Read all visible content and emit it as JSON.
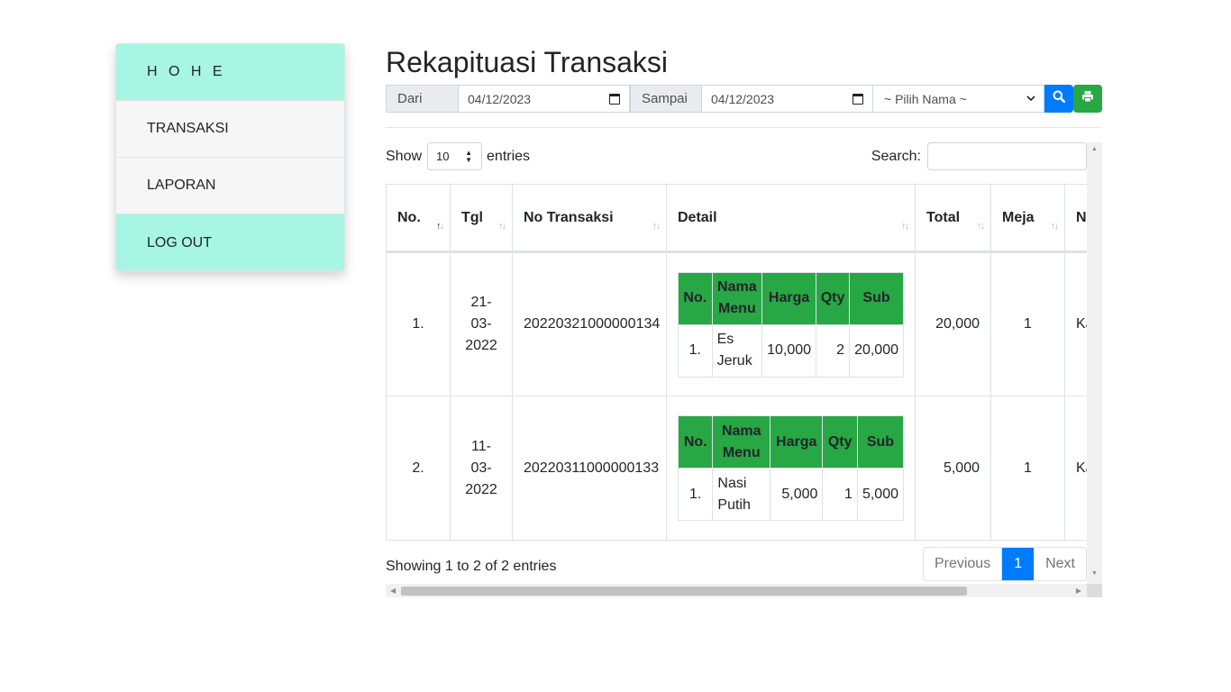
{
  "sidebar": {
    "items": [
      {
        "label": "H O H E"
      },
      {
        "label": "TRANSAKSI"
      },
      {
        "label": "LAPORAN"
      },
      {
        "label": "LOG OUT"
      }
    ]
  },
  "page": {
    "title": "Rekapituasi Transaksi"
  },
  "filter": {
    "from_label": "Dari",
    "from_value": "04/12/2023",
    "to_label": "Sampai",
    "to_value": "04/12/2023",
    "name_placeholder": "~ Pilih Nama ~"
  },
  "datatable": {
    "show_label": "Show",
    "page_length": "10",
    "entries_label": "entries",
    "search_label": "Search:",
    "columns": [
      "No.",
      "Tgl",
      "No Transaksi",
      "Detail",
      "Total",
      "Meja",
      "N K"
    ],
    "rows": [
      {
        "no": "1.",
        "tgl": "21-03-2022",
        "no_transaksi": "20220321000000134",
        "detail": {
          "headers": [
            "No.",
            "Nama Menu",
            "Harga",
            "Qty",
            "Sub"
          ],
          "items": [
            {
              "no": "1.",
              "menu": "Es Jeruk",
              "harga": "10,000",
              "qty": "2",
              "sub": "20,000"
            }
          ]
        },
        "total": "20,000",
        "meja": "1",
        "extra": "Ka Se"
      },
      {
        "no": "2.",
        "tgl": "11-03-2022",
        "no_transaksi": "20220311000000133",
        "detail": {
          "headers": [
            "No.",
            "Nama Menu",
            "Harga",
            "Qty",
            "Sub"
          ],
          "items": [
            {
              "no": "1.",
              "menu": "Nasi Putih",
              "harga": "5,000",
              "qty": "1",
              "sub": "5,000"
            }
          ]
        },
        "total": "5,000",
        "meja": "1",
        "extra": "Ka La"
      }
    ],
    "info": "Showing 1 to 2 of 2 entries",
    "pagination": {
      "previous": "Previous",
      "current": "1",
      "next": "Next"
    }
  },
  "colors": {
    "sidebar_accent": "#a6f6e3",
    "primary": "#007bff",
    "success": "#28a745"
  },
  "icons": {
    "search": "search-icon",
    "print": "print-icon",
    "calendar": "calendar-icon"
  }
}
